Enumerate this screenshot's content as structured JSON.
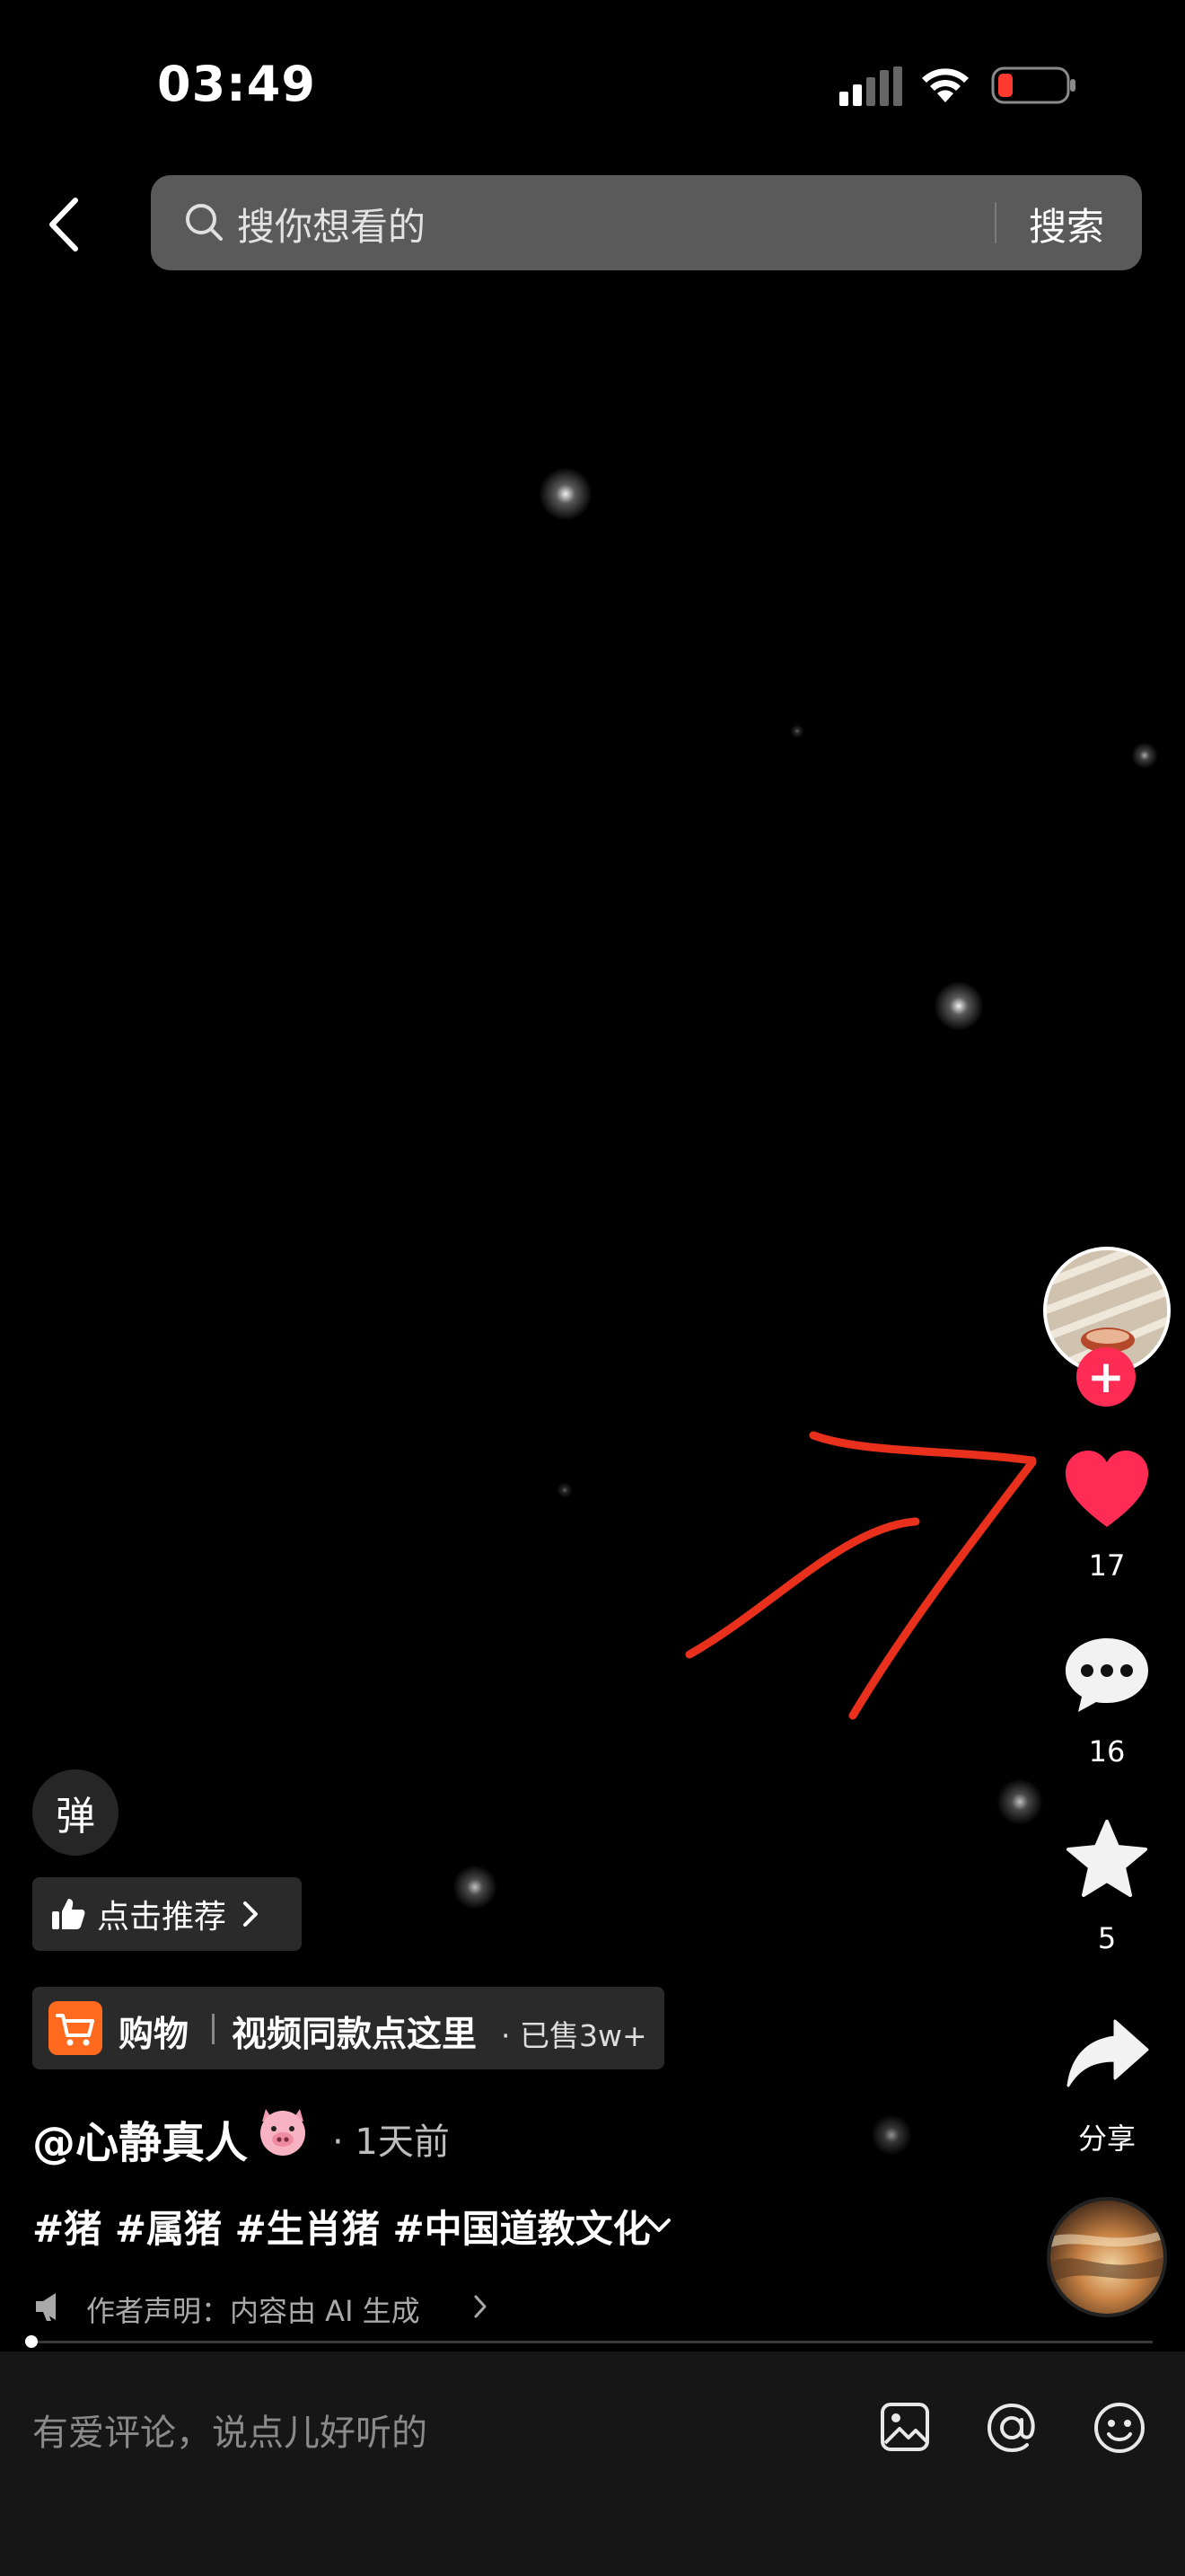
{
  "status_bar": {
    "time": "03:49"
  },
  "search": {
    "placeholder": "搜你想看的",
    "button_label": "搜索"
  },
  "rail": {
    "likes": "17",
    "comments": "16",
    "favorites": "5",
    "share_label": "分享"
  },
  "overlay": {
    "danmaku_label": "弹",
    "recommend_label": "点击推荐",
    "shop": {
      "label": "购物",
      "description": "视频同款点这里",
      "sold": "· 已售3w+"
    },
    "author": "@心静真人",
    "post_time": "· 1天前",
    "hashtags": "#猪 #属猪 #生肖猪 #中国道教文化",
    "disclaimer": "作者声明：内容由 AI 生成"
  },
  "comment_bar": {
    "placeholder": "有爱评论，说点儿好听的"
  },
  "colors": {
    "like": "#fe2c55",
    "annotation": "#e8301c",
    "shop": "#ff6a1f"
  },
  "icons": [
    "back-icon",
    "search-icon",
    "heart-icon",
    "comment-icon",
    "star-icon",
    "share-icon",
    "image-icon",
    "at-icon",
    "emoji-icon",
    "thumbs-up-icon",
    "cart-icon",
    "megaphone-icon",
    "pig-emoji-icon"
  ]
}
